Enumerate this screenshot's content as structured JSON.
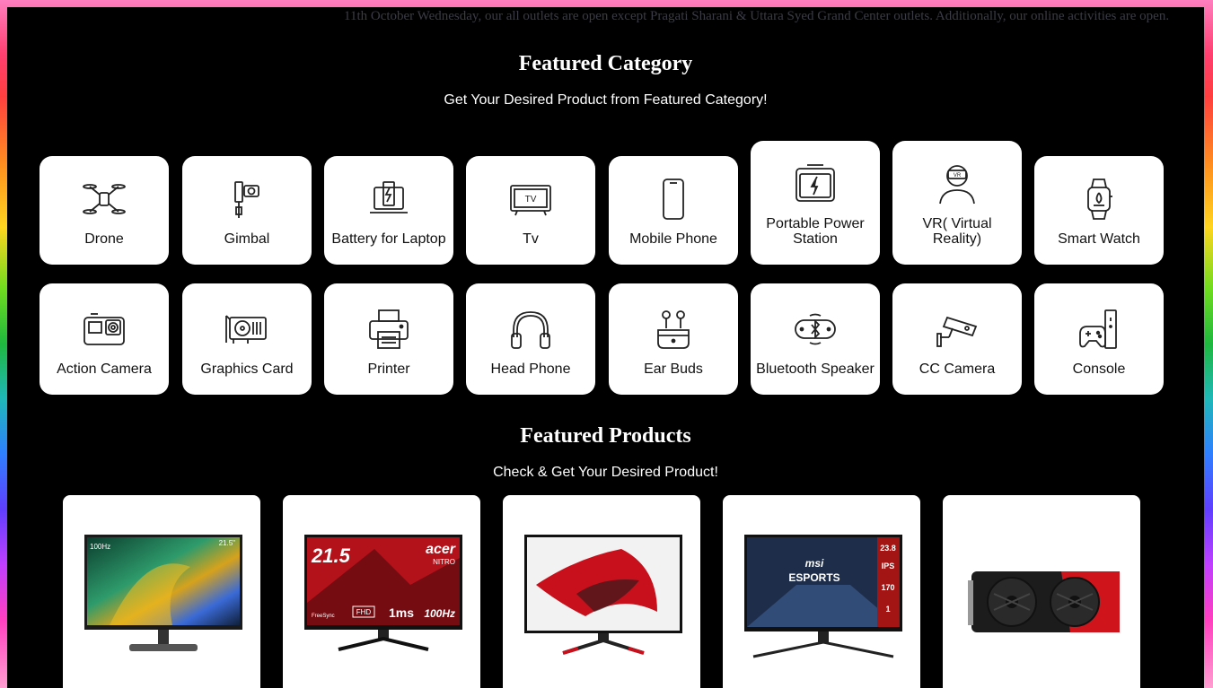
{
  "ticker": {
    "text": "11th October Wednesday, our all outlets are open except Pragati Sharani & Uttara Syed Grand Center outlets. Additionally, our online activities are open."
  },
  "featured_category": {
    "title": "Featured Category",
    "subtitle": "Get Your Desired Product from Featured Category!",
    "items": [
      {
        "label": "Drone",
        "icon": "drone-icon"
      },
      {
        "label": "Gimbal",
        "icon": "gimbal-icon"
      },
      {
        "label": "Battery for Laptop",
        "icon": "laptop-battery-icon"
      },
      {
        "label": "Tv",
        "icon": "tv-icon"
      },
      {
        "label": "Mobile Phone",
        "icon": "mobile-phone-icon"
      },
      {
        "label": "Portable Power Station",
        "icon": "power-station-icon"
      },
      {
        "label": "VR( Virtual Reality)",
        "icon": "vr-headset-icon"
      },
      {
        "label": "Smart Watch",
        "icon": "smart-watch-icon"
      },
      {
        "label": "Action Camera",
        "icon": "action-camera-icon"
      },
      {
        "label": "Graphics Card",
        "icon": "graphics-card-icon"
      },
      {
        "label": "Printer",
        "icon": "printer-icon"
      },
      {
        "label": "Head Phone",
        "icon": "headphone-icon"
      },
      {
        "label": "Ear Buds",
        "icon": "earbuds-icon"
      },
      {
        "label": "Bluetooth Speaker",
        "icon": "bluetooth-speaker-icon"
      },
      {
        "label": "CC Camera",
        "icon": "cctv-camera-icon"
      },
      {
        "label": "Console",
        "icon": "console-icon"
      }
    ]
  },
  "featured_products": {
    "title": "Featured Products",
    "subtitle": "Check & Get Your Desired Product!",
    "items": [
      {
        "image": "acer-monitor-image",
        "screen_text": [
          "100Hz",
          "21.5\""
        ]
      },
      {
        "image": "acer-nitro-monitor-image",
        "screen_text": [
          "21.5",
          "acer",
          "NITRO",
          "FHD",
          "1ms",
          "100Hz",
          "FreeSync"
        ]
      },
      {
        "image": "acer-red-monitor-image",
        "screen_text": []
      },
      {
        "image": "msi-esports-monitor-image",
        "screen_text": [
          "msi",
          "ESPORTS",
          "23.8",
          "IPS",
          "170",
          "1"
        ]
      },
      {
        "image": "graphics-card-image",
        "screen_text": []
      }
    ]
  },
  "colors": {
    "background": "#000000",
    "card": "#ffffff",
    "text_light": "#ffffff",
    "text_dark": "#111111",
    "accent_red": "#d0141c"
  }
}
